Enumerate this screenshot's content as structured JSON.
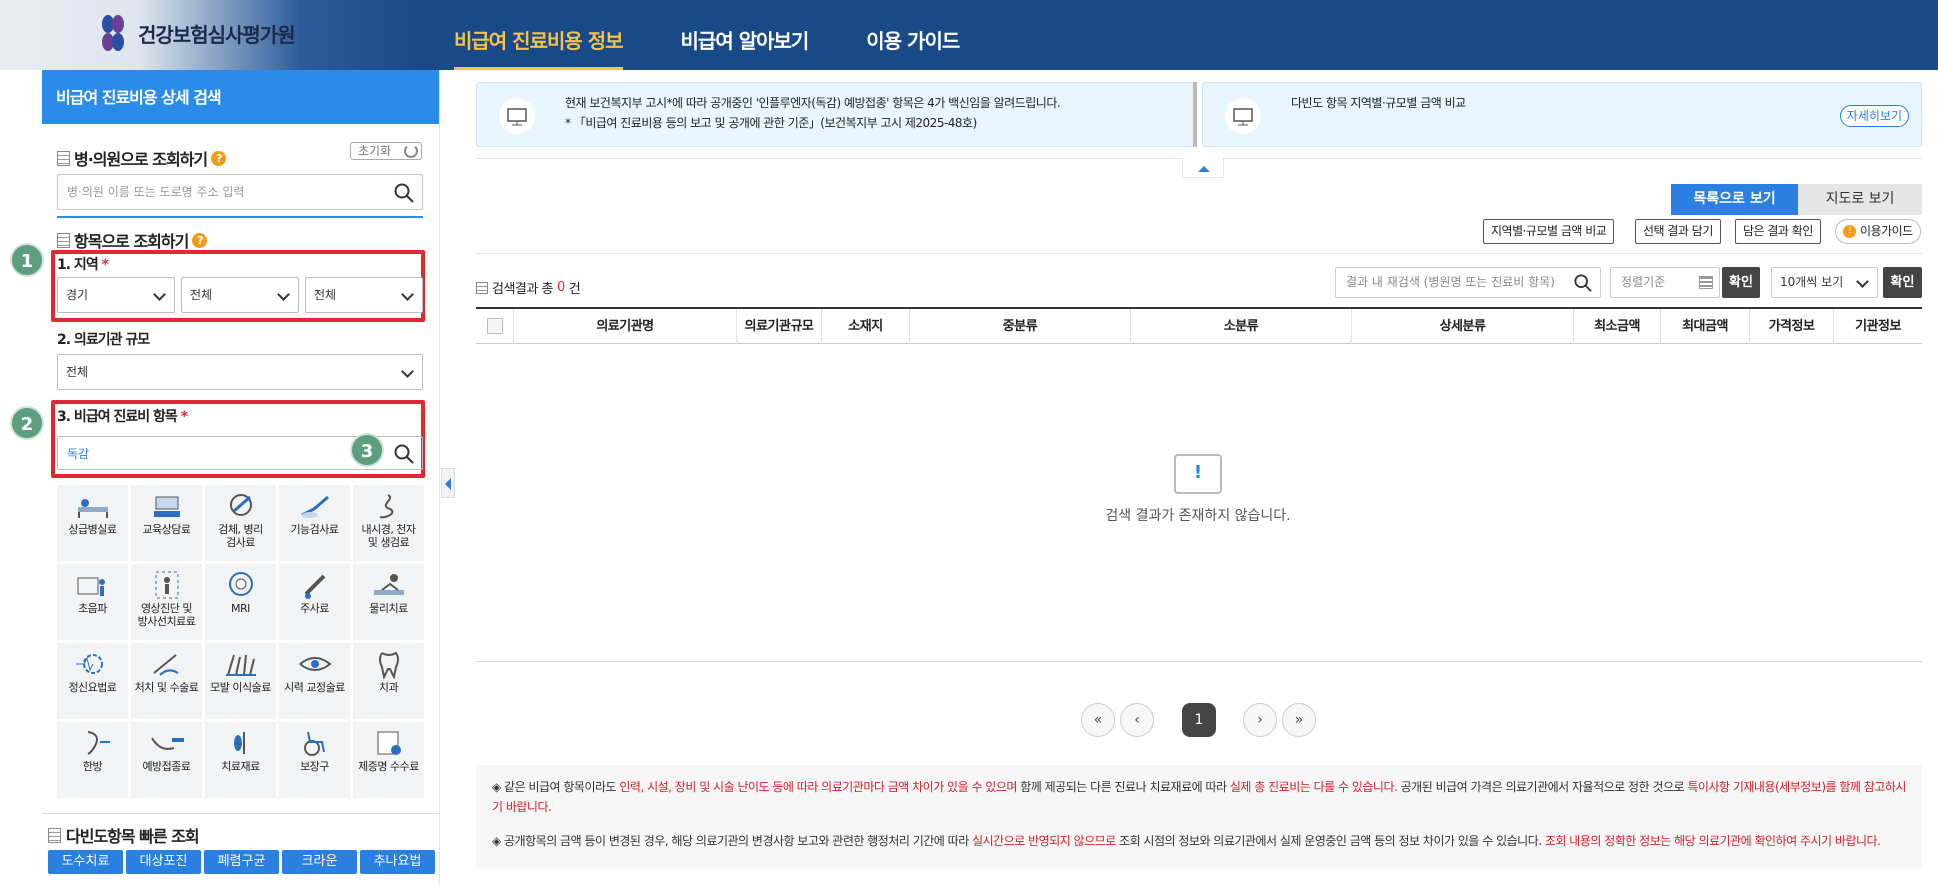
{
  "header": {
    "logo_text": "건강보험심사평가원",
    "nav": [
      "비급여 진료비용 정보",
      "비급여 알아보기",
      "이용 가이드"
    ],
    "active_nav": 0
  },
  "sidebar": {
    "title": "비급여 진료비용 상세 검색",
    "hospital_search_title": "병·의원으로 조회하기",
    "reset_label": "초기화",
    "hospital_placeholder": "병·의원 이름 또는 도로명 주소 입력",
    "item_search_title": "항목으로 조회하기",
    "region_label": "1. 지역",
    "region_values": [
      "경기",
      "전체",
      "전체"
    ],
    "size_label": "2. 의료기관 규모",
    "size_value": "전체",
    "item_label": "3. 비급여 진료비 항목",
    "item_value": "독감",
    "badges": [
      "1",
      "2",
      "3"
    ],
    "categories": [
      {
        "label": "상급병실료",
        "icon": "bed-icon"
      },
      {
        "label": "교육상담료",
        "icon": "counseling-icon"
      },
      {
        "label": "검체, 병리\n검사료",
        "icon": "microscope-icon"
      },
      {
        "label": "기능검사료",
        "icon": "test-icon"
      },
      {
        "label": "내시경, 천자\n및 생검료",
        "icon": "endoscope-icon"
      },
      {
        "label": "초음파",
        "icon": "ultrasound-icon"
      },
      {
        "label": "영상진단 및\n방사선치료료",
        "icon": "xray-icon"
      },
      {
        "label": "MRI",
        "icon": "mri-icon"
      },
      {
        "label": "주사료",
        "icon": "syringe-icon"
      },
      {
        "label": "물리치료",
        "icon": "physio-icon"
      },
      {
        "label": "정신요법료",
        "icon": "brain-icon"
      },
      {
        "label": "처치 및 수술료",
        "icon": "surgery-icon"
      },
      {
        "label": "모발 이식술료",
        "icon": "hair-icon"
      },
      {
        "label": "시력 교정술료",
        "icon": "eye-icon"
      },
      {
        "label": "치과",
        "icon": "tooth-icon"
      },
      {
        "label": "한방",
        "icon": "acupuncture-icon"
      },
      {
        "label": "예방접종료",
        "icon": "vaccine-icon"
      },
      {
        "label": "치료재료",
        "icon": "material-icon"
      },
      {
        "label": "보장구",
        "icon": "wheelchair-icon"
      },
      {
        "label": "제증명 수수료",
        "icon": "certificate-icon"
      }
    ],
    "quick_title": "다빈도항목 빠른 조회",
    "quick_items": [
      "도수치료",
      "대상포진",
      "폐렴구균",
      "크라운",
      "추나요법"
    ]
  },
  "notices": [
    {
      "line1": "현재 보건복지부 고시*에 따라 공개중인 '인플루엔자(독감) 예방접종' 항목은 4가 백신임을 알려드립니다.",
      "line2": "* 「비급여 진료비용 등의 보고 및 공개에 관한 기준」(보건복지부 고시 제2025-48호)"
    },
    {
      "line1": "다빈도 항목 지역별·규모별 금액 비교",
      "more": "자세히보기"
    }
  ],
  "view_tabs": [
    "목록으로 보기",
    "지도로 보기"
  ],
  "actions": [
    "지역별·규모별 금액 비교",
    "선택 결과 담기",
    "담은 결과 확인",
    "이용가이드"
  ],
  "results": {
    "prefix": "검색결과 총",
    "count": "0",
    "suffix": "건",
    "search_placeholder": "결과 내 재검색 (병원명 또는 진료비 항목)",
    "sort_placeholder": "정렬기준",
    "confirm": "확인",
    "per_page": "10개씩 보기",
    "columns": [
      "의료기관명",
      "의료기관규모",
      "소재지",
      "중분류",
      "소분류",
      "상세분류",
      "최소금액",
      "최대금액",
      "가격정보",
      "기관정보"
    ],
    "empty_message": "검색 결과가 존재하지 않습니다."
  },
  "pagination": {
    "first": "«",
    "prev": "‹",
    "current": "1",
    "next": "›",
    "last": "»"
  },
  "info": {
    "p1": [
      {
        "t": "◈ 같은 비급여 항목이라도 "
      },
      {
        "t": "인력, 시설, 장비 및 시술 난이도 등에 따라 의료기관마다 금액 차이가 있을 수 있으며",
        "r": true
      },
      {
        "t": " 함께 제공되는 다른 진료나 치료재료에 따라 "
      },
      {
        "t": "실제 총 진료비는 다를 수 있습니다.",
        "r": true
      },
      {
        "t": " 공개된 비급여 가격은 의료기관에서 자율적으로 정한 것으로 "
      },
      {
        "t": "특이사항 기재내용(세부정보)를 함께 참고하시기 바랍니다.",
        "r": true
      }
    ],
    "p2": [
      {
        "t": "◈ 공개항목의 금액 등이 변경된 경우, 해당 의료기관의 변경사항 보고와 관련한 행정처리 기간에 따라 "
      },
      {
        "t": "실시간으로 반영되지 않으므로",
        "r": true
      },
      {
        "t": " 조회 시점의 정보와 의료기관에서 실제 운영중인 금액 등의 정보 차이가 있을 수 있습니다. "
      },
      {
        "t": "조회 내용의 정확한 정보는 해당 의료기관에 확인하여 주시기 바랍니다.",
        "r": true
      }
    ]
  },
  "colors": {
    "primary": "#2a8be8",
    "header": "#174a86",
    "accent": "#f4c24a",
    "highlight": "#e02a2f",
    "badge": "#5d9e7f"
  }
}
